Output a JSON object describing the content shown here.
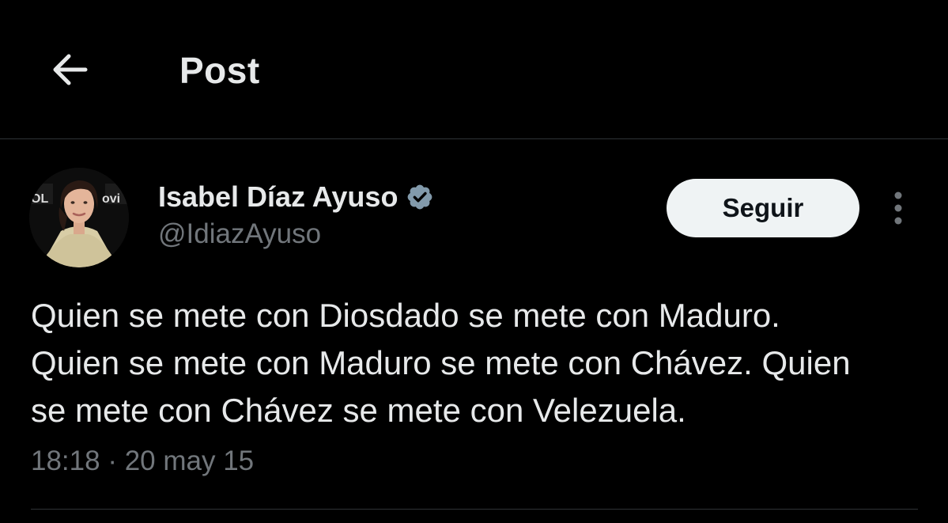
{
  "header": {
    "title": "Post"
  },
  "author": {
    "name": "Isabel Díaz Ayuso",
    "handle": "@IdiazAyuso",
    "verified": true
  },
  "actions": {
    "follow_label": "Seguir"
  },
  "post": {
    "text": "Quien se mete con Diosdado se mete con Maduro.\nQuien se mete con Maduro se mete con Chávez. Quien\nse mete con Chávez se mete con Velezuela.",
    "time": "18:18",
    "separator": "·",
    "date": "20 may 15"
  },
  "colors": {
    "background": "#000000",
    "text": "#e7e9ea",
    "muted": "#71767b",
    "follow_bg": "#eff3f4",
    "verified_badge": "#829aab",
    "divider": "#2f3336"
  },
  "icons": {
    "back": "arrow-left-icon",
    "verified": "verified-badge-icon",
    "more": "more-vertical-icon"
  }
}
